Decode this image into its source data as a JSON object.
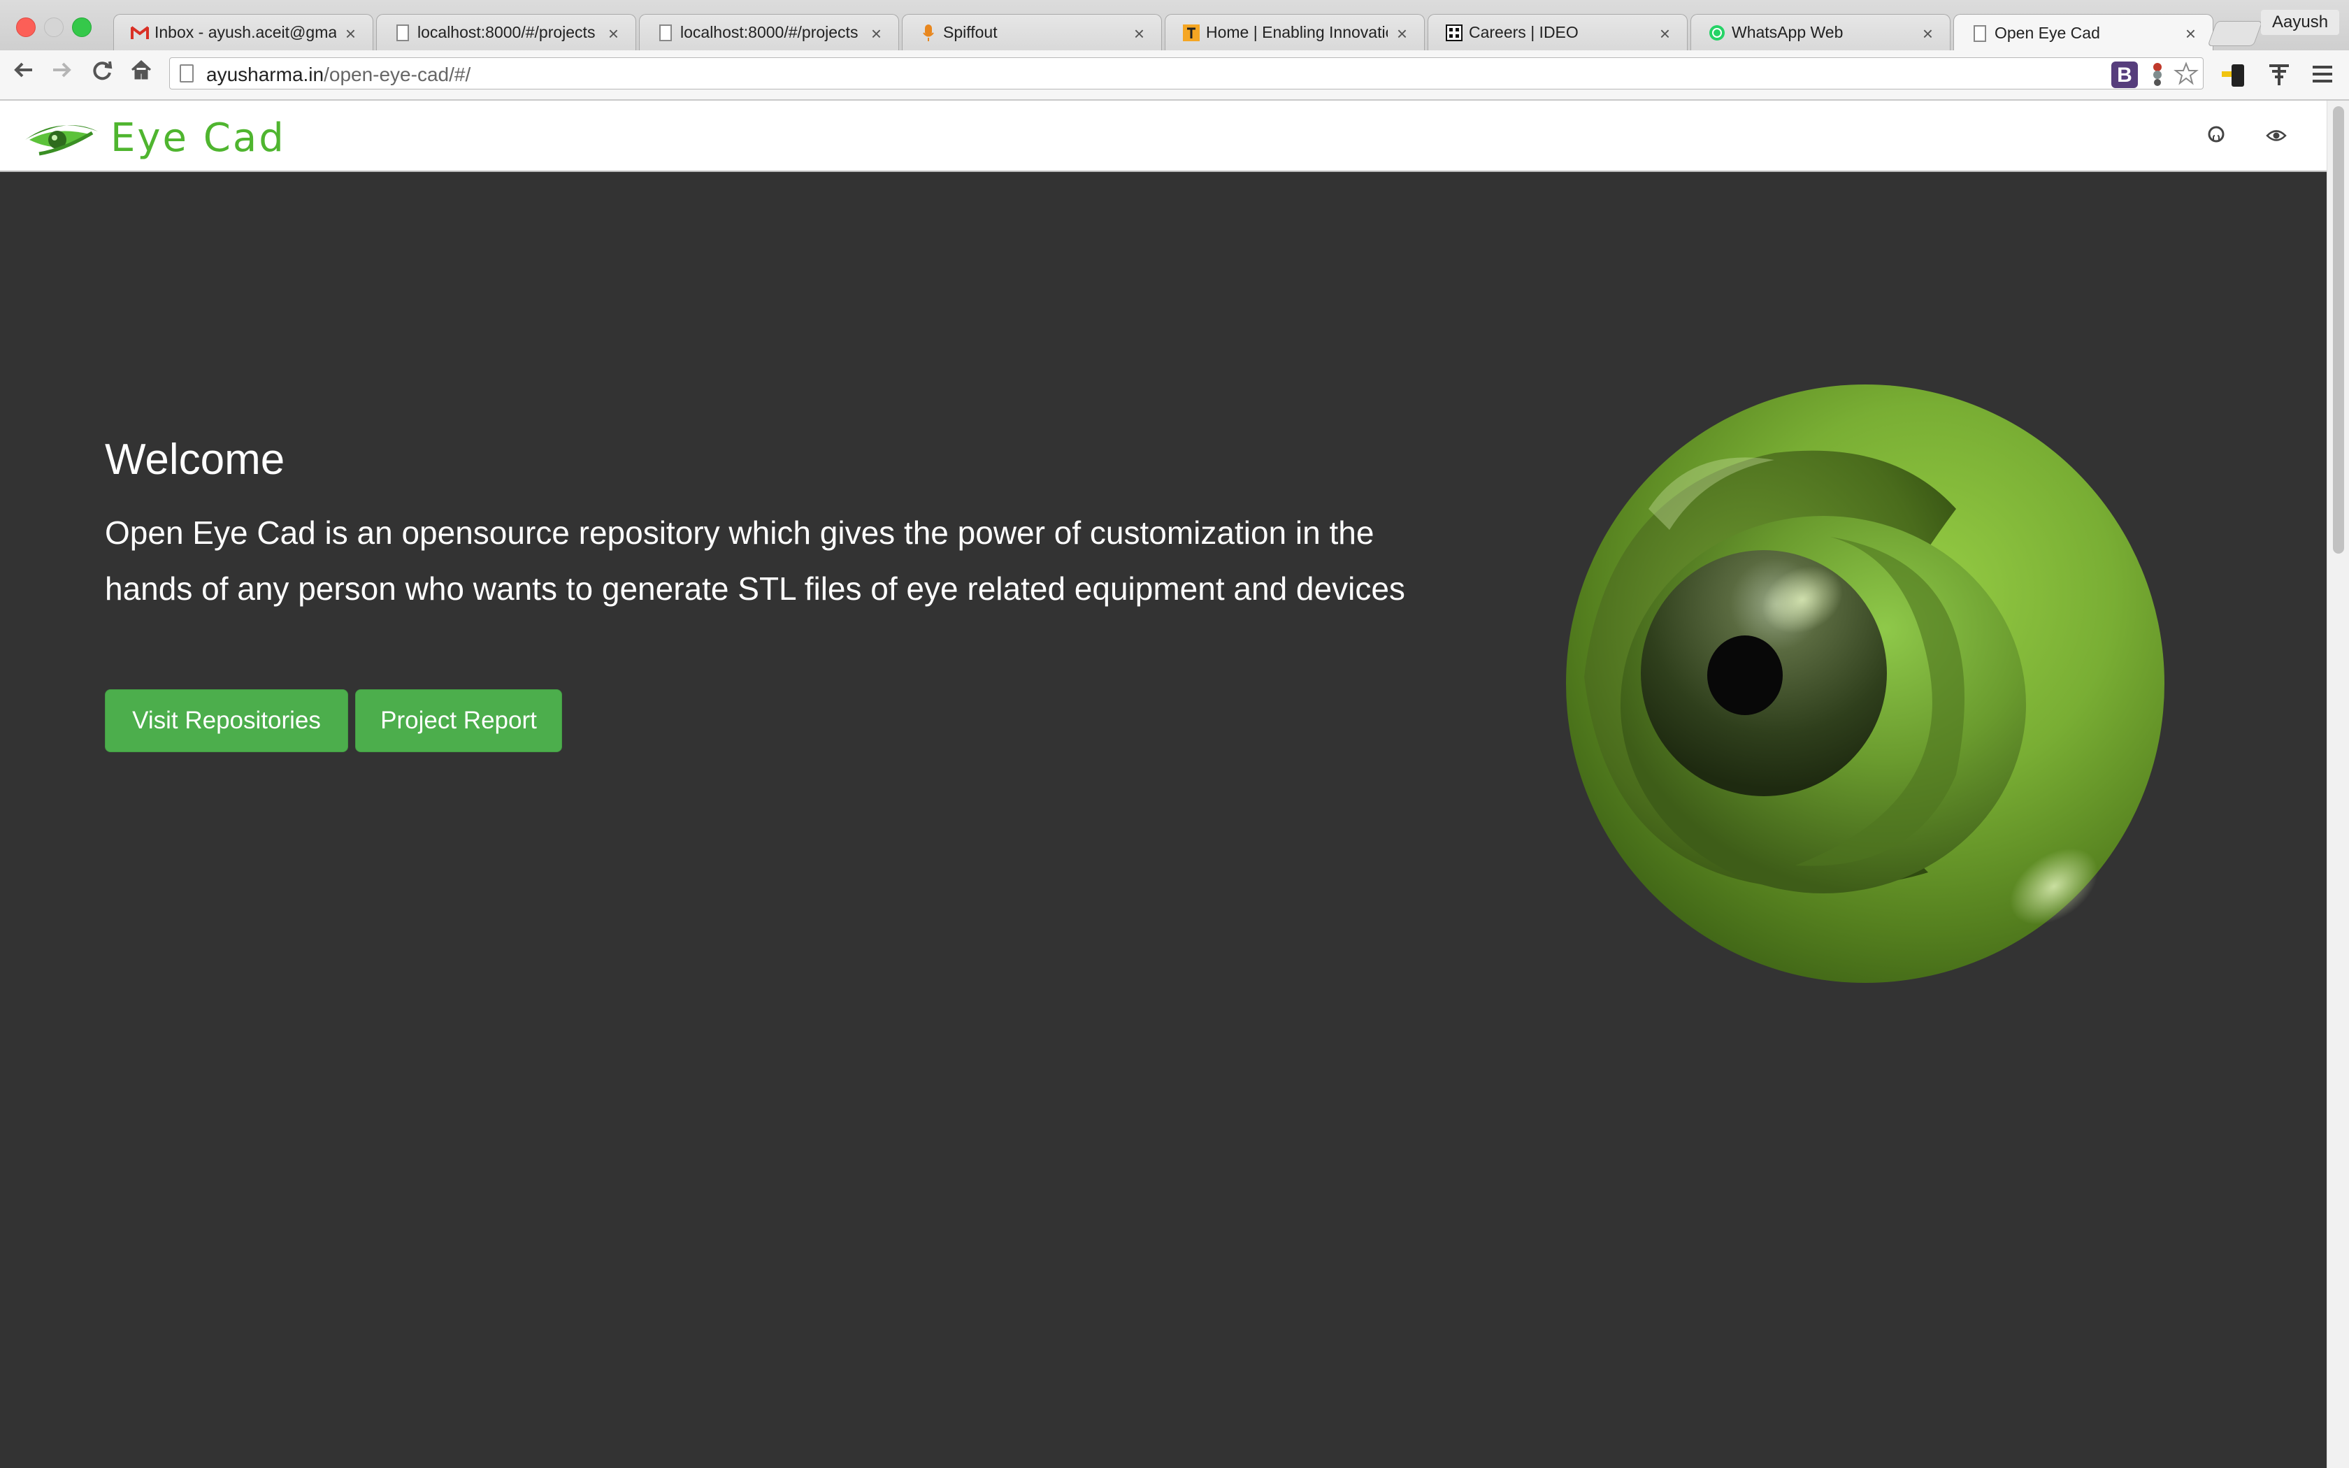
{
  "browser": {
    "tabs": [
      {
        "title": "Inbox - ayush.aceit@gmail.com",
        "favicon": "gmail-icon"
      },
      {
        "title": "localhost:8000/#/projects",
        "favicon": "page-icon"
      },
      {
        "title": "localhost:8000/#/projects",
        "favicon": "page-icon"
      },
      {
        "title": "Spiffout",
        "favicon": "microphone-icon"
      },
      {
        "title": "Home | Enabling Innovation",
        "favicon": "enabling-icon"
      },
      {
        "title": "Careers | IDEO",
        "favicon": "ideo-icon"
      },
      {
        "title": "WhatsApp Web",
        "favicon": "whatsapp-icon"
      },
      {
        "title": "Open Eye Cad",
        "favicon": "page-icon",
        "active": true
      }
    ],
    "tab_close": "×",
    "profile_name": "Aayush",
    "url_host": "ayusharma.in",
    "url_path": "/open-eye-cad/#/",
    "extensions": {
      "bootstrap": "B"
    }
  },
  "site": {
    "brand_text": "Eye Cad",
    "nav_icons": [
      "github-icon",
      "eye-icon"
    ]
  },
  "hero": {
    "title": "Welcome",
    "description": "Open Eye Cad is an opensource repository which gives the power of customization in the hands of any person who wants to generate STL files of eye related equipment and devices",
    "buttons": {
      "repositories": "Visit Repositories",
      "report": "Project Report"
    }
  },
  "colors": {
    "page_bg": "#333333",
    "accent_green": "#4cae4c",
    "brand_green": "#4fb52f"
  }
}
